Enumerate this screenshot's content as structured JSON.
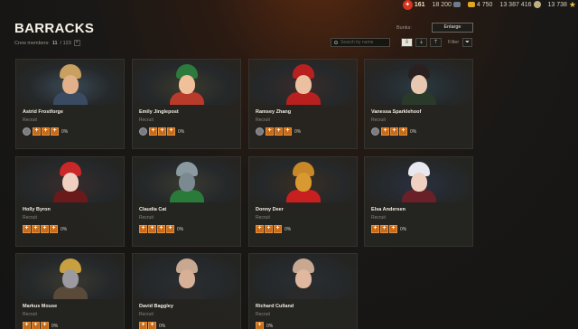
{
  "topbar": {
    "fire": "161",
    "bonds": "18 200",
    "gold": "4 750",
    "credits": "13 387 416",
    "xp": "13 738",
    "icons": [
      "fire-icon",
      "bonds-icon",
      "gold-icon",
      "credits-icon",
      "free-xp-icon",
      "star-icon"
    ]
  },
  "header": {
    "title": "BARRACKS",
    "crew_label": "Crew members:",
    "crew_count": "11",
    "crew_total": "/ 123",
    "bunks_label": "Bunks:",
    "enlarge_label": "Enlarge",
    "search_placeholder": "Search by name",
    "filter_label": "Filter"
  },
  "crew": [
    {
      "name": "Astrid Frostforge",
      "rank": "Recruit",
      "pct": "0%",
      "perk": true,
      "skills": 3,
      "skin": "#e2b08a",
      "hat": "#c8a060",
      "body": "#3a4a60",
      "bg": "#3a4a55"
    },
    {
      "name": "Emily Jinglepost",
      "rank": "Recruit",
      "pct": "0%",
      "perk": true,
      "skills": 3,
      "skin": "#f0c09a",
      "hat": "#2c7a3c",
      "body": "#b83a2a",
      "bg": "#3a3a2c"
    },
    {
      "name": "Ramsey Zhang",
      "rank": "Recruit",
      "pct": "0%",
      "perk": true,
      "skills": 3,
      "skin": "#eac0a0",
      "hat": "#b82020",
      "body": "#b82020",
      "bg": "#3a2c2a"
    },
    {
      "name": "Vanessa Sparklehoof",
      "rank": "Recruit",
      "pct": "0%",
      "perk": true,
      "skills": 3,
      "skin": "#e8c8b0",
      "hat": "#2a2020",
      "body": "#2a3a2a",
      "bg": "#2a3a40"
    },
    {
      "name": "Holly Byron",
      "rank": "Recruit",
      "pct": "0%",
      "perk": false,
      "skills": 4,
      "skin": "#f0d0c0",
      "hat": "#c82828",
      "body": "#6a1a1a",
      "bg": "#3a2c2c"
    },
    {
      "name": "Claudia Cat",
      "rank": "Recruit",
      "pct": "0%",
      "perk": false,
      "skills": 4,
      "skin": "#7a8a90",
      "hat": "#8a9aa0",
      "body": "#2a7a3a",
      "bg": "#3a3a30"
    },
    {
      "name": "Donny Deer",
      "rank": "Recruit",
      "pct": "0%",
      "perk": false,
      "skills": 3,
      "skin": "#d89a30",
      "hat": "#c88828",
      "body": "#c82020",
      "bg": "#3a2e22"
    },
    {
      "name": "Elsa Andersen",
      "rank": "Recruit",
      "pct": "0%",
      "perk": false,
      "skills": 3,
      "skin": "#f0d0c0",
      "hat": "#e8e8f0",
      "body": "#6a2028",
      "bg": "#2a3040"
    },
    {
      "name": "Markus Mouse",
      "rank": "Recruit",
      "pct": "0%",
      "perk": false,
      "skills": 3,
      "skin": "#9a9aa0",
      "hat": "#c8a040",
      "body": "#5a4a3a",
      "bg": "#3a3a30"
    },
    {
      "name": "David Baggley",
      "rank": "Recruit",
      "pct": "0%",
      "perk": false,
      "skills": 2,
      "skin": "#d8b098",
      "hat": "#c8a890",
      "body": "#2a2a2a",
      "bg": "#2a2e32"
    },
    {
      "name": "Richard Culland",
      "rank": "Recruit",
      "pct": "0%",
      "perk": false,
      "skills": 1,
      "skin": "#e0b8a0",
      "hat": "#c8a890",
      "body": "#2a2a2a",
      "bg": "#2a2e32"
    }
  ]
}
